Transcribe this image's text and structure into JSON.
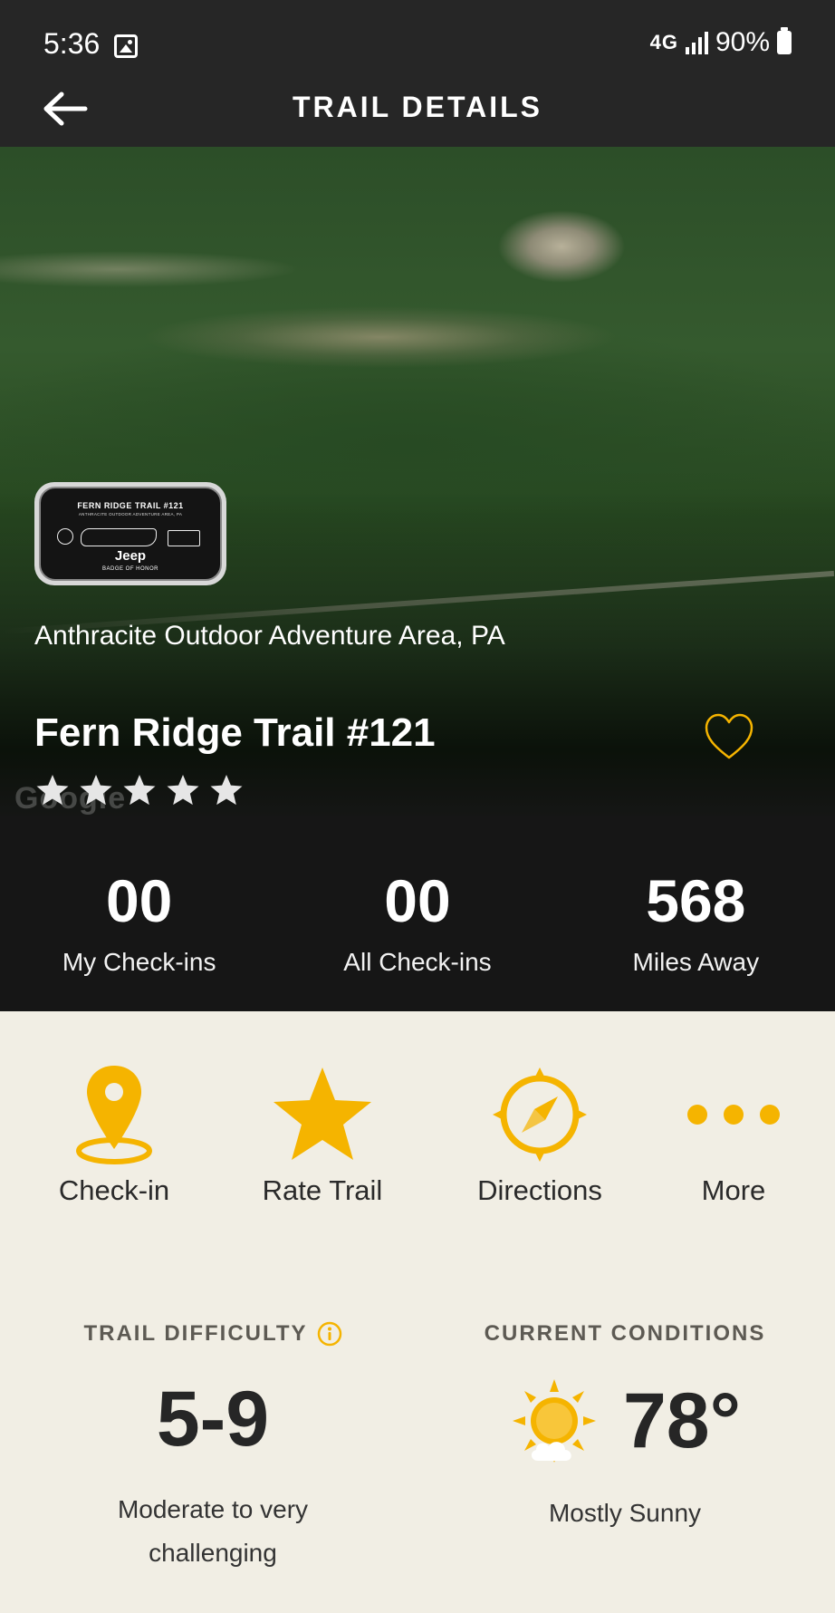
{
  "status_bar": {
    "time": "5:36",
    "network": "4G",
    "battery": "90%",
    "icons": [
      "image-icon",
      "signal-icon",
      "battery-icon"
    ]
  },
  "header": {
    "title": "TRAIL DETAILS",
    "back_icon": "arrow-left-icon"
  },
  "hero": {
    "watermark": "Google",
    "badge": {
      "title": "FERN RIDGE TRAIL #121",
      "subtitle": "ANTHRACITE OUTDOOR ADVENTURE AREA, PA",
      "brand": "Jeep",
      "footer": "BADGE OF HONOR"
    },
    "location": "Anthracite Outdoor Adventure Area, PA",
    "trail_name": "Fern Ridge Trail #121",
    "rating": {
      "stars_total": 5,
      "stars_filled": 0
    },
    "favorite_icon": "heart-outline-icon"
  },
  "stats": [
    {
      "value": "00",
      "label": "My Check-ins"
    },
    {
      "value": "00",
      "label": "All Check-ins"
    },
    {
      "value": "568",
      "label": "Miles Away"
    }
  ],
  "actions": [
    {
      "label": "Check-in",
      "icon": "map-pin-icon"
    },
    {
      "label": "Rate Trail",
      "icon": "star-icon"
    },
    {
      "label": "Directions",
      "icon": "compass-icon"
    },
    {
      "label": "More",
      "icon": "more-dots-icon"
    }
  ],
  "difficulty": {
    "heading": "TRAIL DIFFICULTY",
    "value": "5-9",
    "description_line1": "Moderate to very",
    "description_line2": "challenging"
  },
  "conditions": {
    "heading": "CURRENT CONDITIONS",
    "temperature": "78°",
    "description": "Mostly Sunny",
    "icon": "partly-sunny-icon"
  },
  "colors": {
    "accent": "#f5b400",
    "dark": "#262626",
    "stats_bg": "#161616",
    "page_bg": "#f1eee4"
  }
}
